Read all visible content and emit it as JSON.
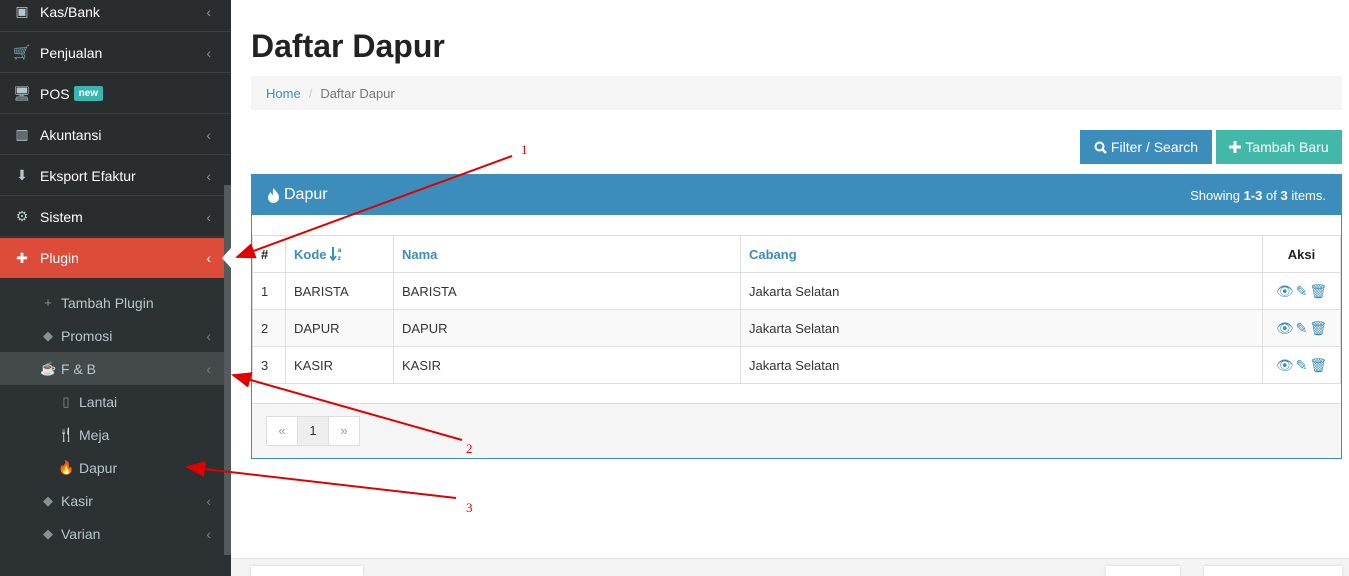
{
  "sidebar": {
    "items": [
      {
        "label": "Kas/Bank",
        "icon": "money-icon",
        "glyph": "▣",
        "has_chevron": true
      },
      {
        "label": "Penjualan",
        "icon": "cart-icon",
        "glyph": "🛒",
        "has_chevron": true
      },
      {
        "label": "POS",
        "icon": "monitor-icon",
        "glyph": "🖥",
        "badge": "new",
        "has_chevron": false
      },
      {
        "label": "Akuntansi",
        "icon": "bar-chart-icon",
        "glyph": "▥",
        "has_chevron": true
      },
      {
        "label": "Eksport Efaktur",
        "icon": "export-icon",
        "glyph": "⬇",
        "has_chevron": true
      },
      {
        "label": "Sistem",
        "icon": "gears-icon",
        "glyph": "⚙",
        "has_chevron": true
      },
      {
        "label": "Plugin",
        "icon": "puzzle-icon",
        "glyph": "✚",
        "has_chevron": true,
        "active": true
      }
    ],
    "plugin_submenu": [
      {
        "label": "Tambah Plugin",
        "icon": "plus-icon",
        "glyph": "+",
        "has_chevron": false
      },
      {
        "label": "Promosi",
        "icon": "tags-icon",
        "glyph": "◆",
        "has_chevron": true
      },
      {
        "label": "F & B",
        "icon": "coffee-icon",
        "glyph": "☕",
        "has_chevron": true,
        "highlight": true
      },
      {
        "label": "Lantai",
        "icon": "building-icon",
        "glyph": "▯",
        "level": 3
      },
      {
        "label": "Meja",
        "icon": "cutlery-icon",
        "glyph": "🍴",
        "level": 3
      },
      {
        "label": "Dapur",
        "icon": "fire-icon",
        "glyph": "🔥",
        "level": 3
      },
      {
        "label": "Kasir",
        "icon": "tags-icon",
        "glyph": "◆",
        "has_chevron": true
      },
      {
        "label": "Varian",
        "icon": "tags-icon",
        "glyph": "◆",
        "has_chevron": true
      }
    ],
    "chevron": "‹"
  },
  "page": {
    "title": "Daftar Dapur",
    "breadcrumb": {
      "home": "Home",
      "separator": "/",
      "current": "Daftar Dapur"
    }
  },
  "toolbar": {
    "filter_label": "Filter / Search",
    "add_label": "Tambah Baru"
  },
  "panel": {
    "title": "Dapur",
    "summary_prefix": "Showing ",
    "summary_range": "1-3",
    "summary_of": " of ",
    "summary_total": "3",
    "summary_suffix": " items."
  },
  "table": {
    "headers": {
      "num": "#",
      "kode": "Kode",
      "nama": "Nama",
      "cabang": "Cabang",
      "aksi": "Aksi"
    },
    "rows": [
      {
        "num": "1",
        "kode": "BARISTA",
        "nama": "BARISTA",
        "cabang": "Jakarta Selatan"
      },
      {
        "num": "2",
        "kode": "DAPUR",
        "nama": "DAPUR",
        "cabang": "Jakarta Selatan"
      },
      {
        "num": "3",
        "kode": "KASIR",
        "nama": "KASIR",
        "cabang": "Jakarta Selatan"
      }
    ]
  },
  "pagination": {
    "prev": "«",
    "current": "1",
    "next": "»"
  },
  "annotations": {
    "a1": "1",
    "a2": "2",
    "a3": "3"
  },
  "colors": {
    "primary": "#3c8dbc",
    "active_menu": "#dd4b39",
    "success": "#41b8a8",
    "annotation": "#e00000"
  }
}
